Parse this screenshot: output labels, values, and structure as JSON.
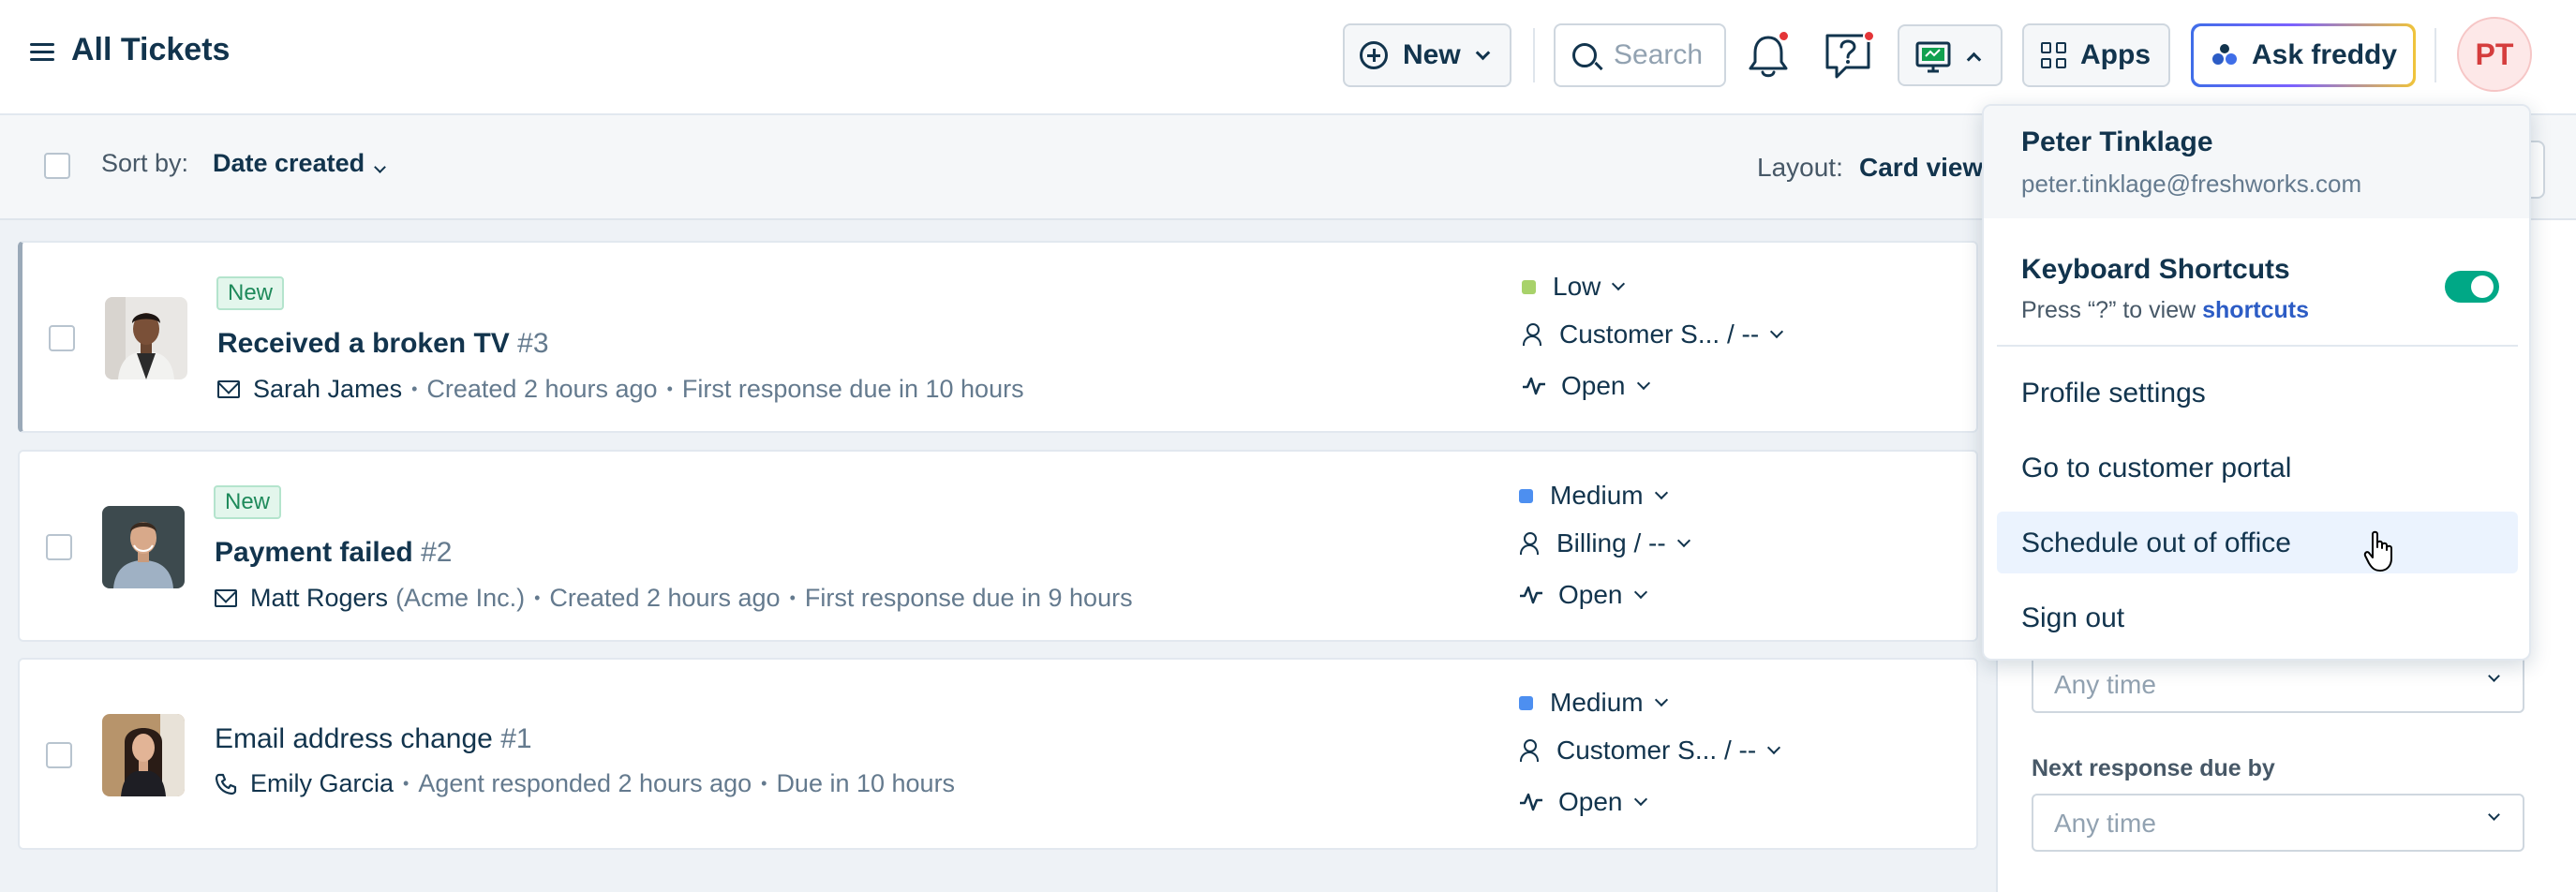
{
  "header": {
    "title": "All Tickets",
    "new_label": "New",
    "search_placeholder": "Search",
    "apps_label": "Apps",
    "freddy_label": "Ask freddy",
    "avatar_initials": "PT"
  },
  "toolbar": {
    "sort_label": "Sort by:",
    "sort_value": "Date created",
    "layout_label": "Layout:",
    "layout_value": "Card view"
  },
  "tickets": [
    {
      "badge": "New",
      "title": "Received a broken TV",
      "number": "#3",
      "requester": "Sarah James",
      "org": "",
      "created": "Created 2 hours ago",
      "due": "First response due in 10 hours",
      "priority": "Low",
      "priority_color": "#a8d26a",
      "group": "Customer S... / --",
      "status": "Open",
      "channel_icon": "envelope-icon"
    },
    {
      "badge": "New",
      "title": "Payment failed",
      "number": "#2",
      "requester": "Matt Rogers",
      "org": "(Acme Inc.)",
      "created": "Created 2 hours ago",
      "due": "First response due in 9 hours",
      "priority": "Medium",
      "priority_color": "#4d8ff0",
      "group": "Billing / --",
      "status": "Open",
      "channel_icon": "envelope-icon"
    },
    {
      "badge": "",
      "title": "Email address change",
      "number": "#1",
      "requester": "Emily Garcia",
      "org": "",
      "created": "Agent responded 2 hours ago",
      "due": "Due in 10 hours",
      "priority": "Medium",
      "priority_color": "#4d8ff0",
      "group": "Customer S... / --",
      "status": "Open",
      "channel_icon": "phone-icon"
    }
  ],
  "filters": {
    "select_1_value": "Any time",
    "next_response_label": "Next response due by",
    "select_2_value": "Any time"
  },
  "profile_menu": {
    "name": "Peter Tinklage",
    "email": "peter.tinklage@freshworks.com",
    "shortcuts_title": "Keyboard Shortcuts",
    "shortcuts_hint": "Press “?” to view",
    "shortcuts_link": "shortcuts",
    "shortcuts_enabled": true,
    "items": [
      "Profile settings",
      "Go to customer portal",
      "Schedule out of office",
      "Sign out"
    ],
    "hovered_item": "Schedule out of office"
  },
  "colors": {
    "accent": "#2c5cc5",
    "toggle_on": "#00a886",
    "notification_dot": "#e43538",
    "new_badge": "#1f8a5b"
  }
}
